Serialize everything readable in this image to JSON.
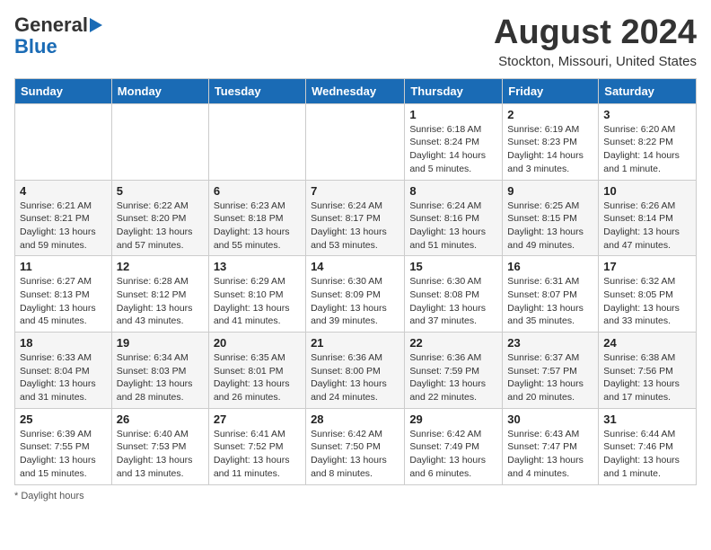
{
  "header": {
    "logo_line1": "General",
    "logo_line2": "Blue",
    "month": "August 2024",
    "location": "Stockton, Missouri, United States"
  },
  "days_of_week": [
    "Sunday",
    "Monday",
    "Tuesday",
    "Wednesday",
    "Thursday",
    "Friday",
    "Saturday"
  ],
  "weeks": [
    [
      {
        "day": "",
        "info": ""
      },
      {
        "day": "",
        "info": ""
      },
      {
        "day": "",
        "info": ""
      },
      {
        "day": "",
        "info": ""
      },
      {
        "day": "1",
        "info": "Sunrise: 6:18 AM\nSunset: 8:24 PM\nDaylight: 14 hours\nand 5 minutes."
      },
      {
        "day": "2",
        "info": "Sunrise: 6:19 AM\nSunset: 8:23 PM\nDaylight: 14 hours\nand 3 minutes."
      },
      {
        "day": "3",
        "info": "Sunrise: 6:20 AM\nSunset: 8:22 PM\nDaylight: 14 hours\nand 1 minute."
      }
    ],
    [
      {
        "day": "4",
        "info": "Sunrise: 6:21 AM\nSunset: 8:21 PM\nDaylight: 13 hours\nand 59 minutes."
      },
      {
        "day": "5",
        "info": "Sunrise: 6:22 AM\nSunset: 8:20 PM\nDaylight: 13 hours\nand 57 minutes."
      },
      {
        "day": "6",
        "info": "Sunrise: 6:23 AM\nSunset: 8:18 PM\nDaylight: 13 hours\nand 55 minutes."
      },
      {
        "day": "7",
        "info": "Sunrise: 6:24 AM\nSunset: 8:17 PM\nDaylight: 13 hours\nand 53 minutes."
      },
      {
        "day": "8",
        "info": "Sunrise: 6:24 AM\nSunset: 8:16 PM\nDaylight: 13 hours\nand 51 minutes."
      },
      {
        "day": "9",
        "info": "Sunrise: 6:25 AM\nSunset: 8:15 PM\nDaylight: 13 hours\nand 49 minutes."
      },
      {
        "day": "10",
        "info": "Sunrise: 6:26 AM\nSunset: 8:14 PM\nDaylight: 13 hours\nand 47 minutes."
      }
    ],
    [
      {
        "day": "11",
        "info": "Sunrise: 6:27 AM\nSunset: 8:13 PM\nDaylight: 13 hours\nand 45 minutes."
      },
      {
        "day": "12",
        "info": "Sunrise: 6:28 AM\nSunset: 8:12 PM\nDaylight: 13 hours\nand 43 minutes."
      },
      {
        "day": "13",
        "info": "Sunrise: 6:29 AM\nSunset: 8:10 PM\nDaylight: 13 hours\nand 41 minutes."
      },
      {
        "day": "14",
        "info": "Sunrise: 6:30 AM\nSunset: 8:09 PM\nDaylight: 13 hours\nand 39 minutes."
      },
      {
        "day": "15",
        "info": "Sunrise: 6:30 AM\nSunset: 8:08 PM\nDaylight: 13 hours\nand 37 minutes."
      },
      {
        "day": "16",
        "info": "Sunrise: 6:31 AM\nSunset: 8:07 PM\nDaylight: 13 hours\nand 35 minutes."
      },
      {
        "day": "17",
        "info": "Sunrise: 6:32 AM\nSunset: 8:05 PM\nDaylight: 13 hours\nand 33 minutes."
      }
    ],
    [
      {
        "day": "18",
        "info": "Sunrise: 6:33 AM\nSunset: 8:04 PM\nDaylight: 13 hours\nand 31 minutes."
      },
      {
        "day": "19",
        "info": "Sunrise: 6:34 AM\nSunset: 8:03 PM\nDaylight: 13 hours\nand 28 minutes."
      },
      {
        "day": "20",
        "info": "Sunrise: 6:35 AM\nSunset: 8:01 PM\nDaylight: 13 hours\nand 26 minutes."
      },
      {
        "day": "21",
        "info": "Sunrise: 6:36 AM\nSunset: 8:00 PM\nDaylight: 13 hours\nand 24 minutes."
      },
      {
        "day": "22",
        "info": "Sunrise: 6:36 AM\nSunset: 7:59 PM\nDaylight: 13 hours\nand 22 minutes."
      },
      {
        "day": "23",
        "info": "Sunrise: 6:37 AM\nSunset: 7:57 PM\nDaylight: 13 hours\nand 20 minutes."
      },
      {
        "day": "24",
        "info": "Sunrise: 6:38 AM\nSunset: 7:56 PM\nDaylight: 13 hours\nand 17 minutes."
      }
    ],
    [
      {
        "day": "25",
        "info": "Sunrise: 6:39 AM\nSunset: 7:55 PM\nDaylight: 13 hours\nand 15 minutes."
      },
      {
        "day": "26",
        "info": "Sunrise: 6:40 AM\nSunset: 7:53 PM\nDaylight: 13 hours\nand 13 minutes."
      },
      {
        "day": "27",
        "info": "Sunrise: 6:41 AM\nSunset: 7:52 PM\nDaylight: 13 hours\nand 11 minutes."
      },
      {
        "day": "28",
        "info": "Sunrise: 6:42 AM\nSunset: 7:50 PM\nDaylight: 13 hours\nand 8 minutes."
      },
      {
        "day": "29",
        "info": "Sunrise: 6:42 AM\nSunset: 7:49 PM\nDaylight: 13 hours\nand 6 minutes."
      },
      {
        "day": "30",
        "info": "Sunrise: 6:43 AM\nSunset: 7:47 PM\nDaylight: 13 hours\nand 4 minutes."
      },
      {
        "day": "31",
        "info": "Sunrise: 6:44 AM\nSunset: 7:46 PM\nDaylight: 13 hours\nand 1 minute."
      }
    ]
  ],
  "footer": {
    "note": "Daylight hours"
  }
}
